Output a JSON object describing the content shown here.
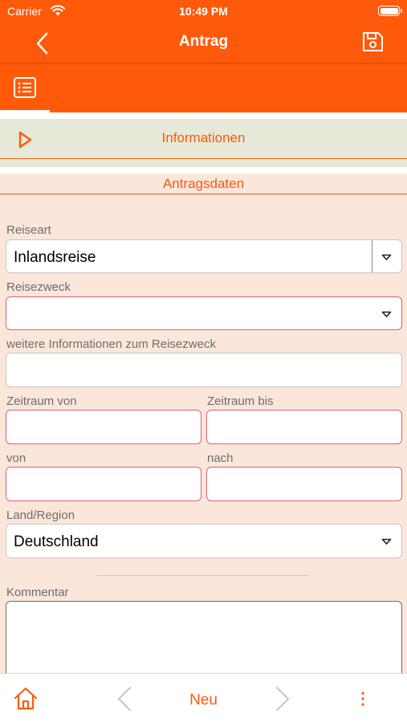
{
  "status_bar": {
    "carrier": "Carrier",
    "time": "10:49 PM"
  },
  "nav": {
    "title": "Antrag"
  },
  "sections": {
    "information": "Informationen",
    "application_data": "Antragsdaten"
  },
  "form": {
    "travel_type": {
      "label": "Reiseart",
      "value": "Inlandsreise"
    },
    "travel_purpose": {
      "label": "Reisezweck",
      "value": ""
    },
    "purpose_info": {
      "label": "weitere Informationen zum Reisezweck",
      "value": ""
    },
    "period_from": {
      "label": "Zeitraum von",
      "value": ""
    },
    "period_to": {
      "label": "Zeitraum bis",
      "value": ""
    },
    "from": {
      "label": "von",
      "value": ""
    },
    "to": {
      "label": "nach",
      "value": ""
    },
    "country": {
      "label": "Land/Region",
      "value": "Deutschland"
    },
    "comment": {
      "label": "Kommentar",
      "value": ""
    }
  },
  "bottom_bar": {
    "new_label": "Neu"
  },
  "colors": {
    "accent": "#fe5a0a",
    "background": "#fbe6da",
    "required_border": "#e06074"
  },
  "icons": [
    "back-chevron-icon",
    "save-icon",
    "list-icon",
    "play-icon",
    "home-icon",
    "prev-chevron-icon",
    "next-chevron-icon",
    "more-dots-icon",
    "dropdown-arrow-icon",
    "wifi-icon",
    "battery-icon"
  ]
}
